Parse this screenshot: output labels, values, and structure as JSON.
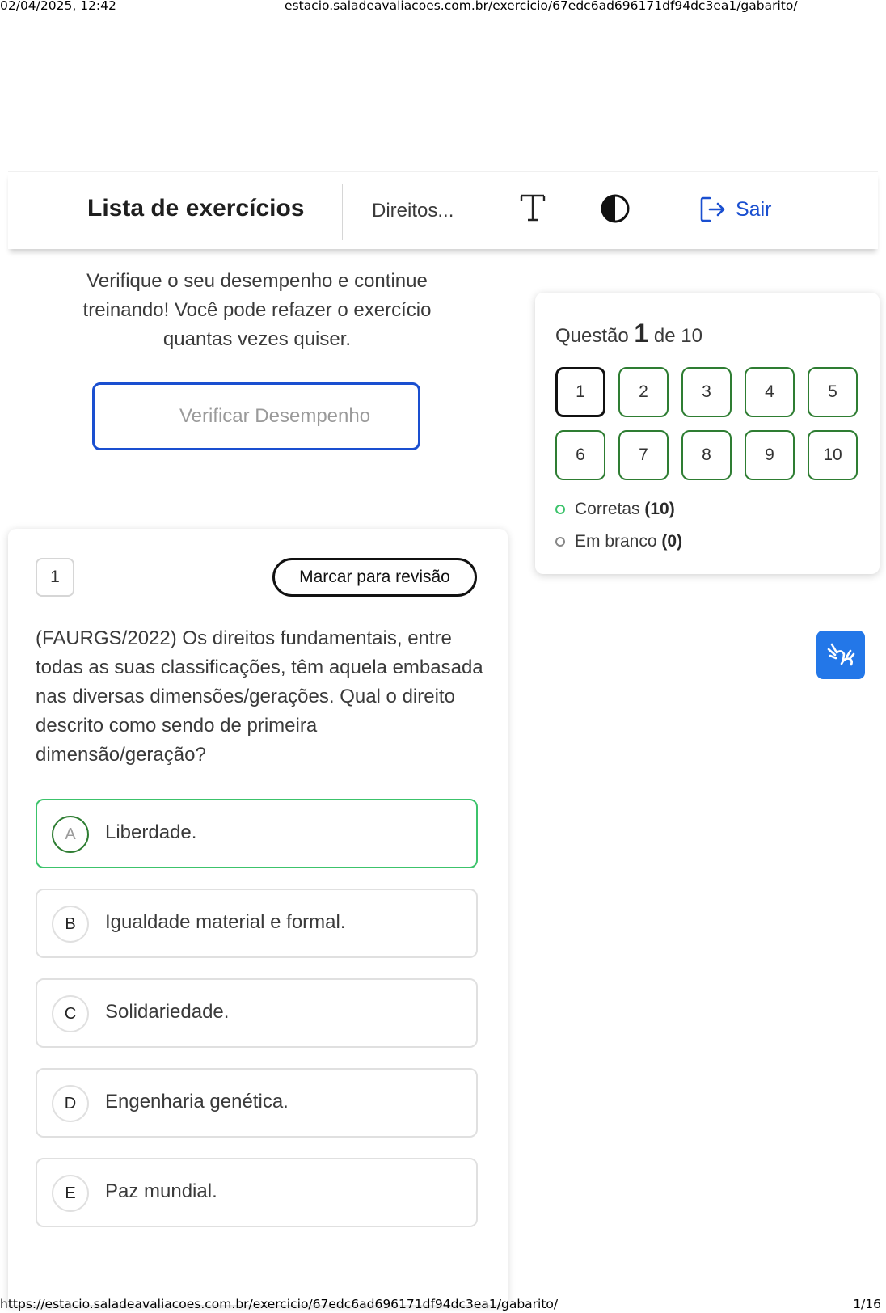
{
  "print": {
    "datetime": "02/04/2025, 12:42",
    "url_header": "estacio.saladeavaliacoes.com.br/exercicio/67edc6ad696171df94dc3ea1/gabarito/",
    "url_footer": "https://estacio.saladeavaliacoes.com.br/exercicio/67edc6ad696171df94dc3ea1/gabarito/",
    "page": "1/16"
  },
  "header": {
    "title": "Lista de exercícios",
    "subject": "Direitos...",
    "font_icon": "font-size-icon",
    "contrast_icon": "contrast-icon",
    "exit_icon": "logout-icon",
    "exit_label": "Sair",
    "accent": "#1a4fd0"
  },
  "performance": {
    "message": "Verifique o seu desempenho e continue treinando! Você pode refazer o exercício quantas vezes quiser.",
    "verify_label": "Verificar Desempenho"
  },
  "navigator": {
    "title_prefix": "Questão",
    "current": "1",
    "title_suffix": "de 10",
    "questions": [
      "1",
      "2",
      "3",
      "4",
      "5",
      "6",
      "7",
      "8",
      "9",
      "10"
    ],
    "correct_label": "Corretas",
    "correct_count": "(10)",
    "blank_label": "Em branco",
    "blank_count": "(0)",
    "correct_color": "#2e7d32"
  },
  "libras": {
    "icon": "sign-language-icon"
  },
  "question": {
    "number": "1",
    "mark_review_label": "Marcar para revisão",
    "statement": "(FAURGS/2022) Os direitos fundamentais, entre todas as suas classificações, têm aquela embasada nas diversas dimensões/gerações. Qual o direito descrito como sendo de primeira dimensão/geração?",
    "options": [
      {
        "letter": "A",
        "text": "Liberdade."
      },
      {
        "letter": "B",
        "text": "Igualdade material e formal."
      },
      {
        "letter": "C",
        "text": "Solidariedade."
      },
      {
        "letter": "D",
        "text": "Engenharia genética."
      },
      {
        "letter": "E",
        "text": "Paz mundial."
      }
    ],
    "correct_option": "A",
    "correct_border": "#3cc36b"
  }
}
